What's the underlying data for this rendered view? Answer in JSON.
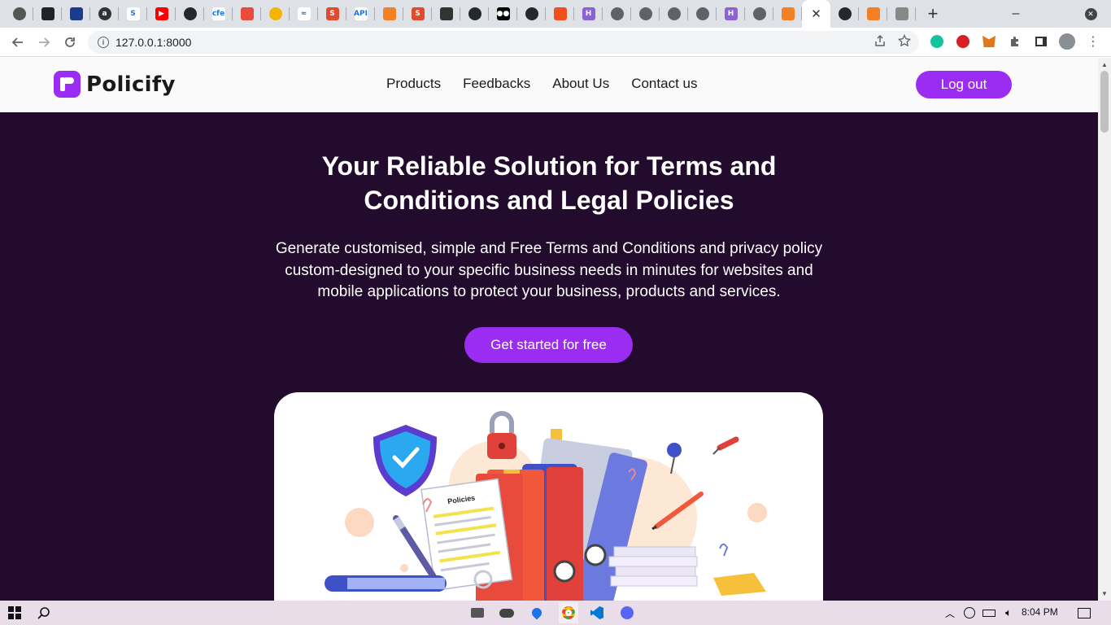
{
  "browser": {
    "tabs": [
      {
        "icon": "chrome-icon",
        "glyph": "",
        "color": "#555555"
      },
      {
        "icon": "react-icon",
        "glyph": "",
        "color": "#20232a"
      },
      {
        "icon": "flame-icon",
        "glyph": "",
        "color": "#1e3a8a"
      },
      {
        "icon": "a-circle-icon",
        "glyph": "a",
        "color": "#333333"
      },
      {
        "icon": "s-letter-icon",
        "glyph": "S",
        "color": "#ffffff"
      },
      {
        "icon": "youtube-icon",
        "glyph": "▶",
        "color": "#ff0000"
      },
      {
        "icon": "github-icon",
        "glyph": "",
        "color": "#24292e"
      },
      {
        "icon": "cfe-icon",
        "glyph": "cfe",
        "color": "#ffffff"
      },
      {
        "icon": "shield-red-icon",
        "glyph": "",
        "color": "#e74c3c"
      },
      {
        "icon": "colorful-circle-icon",
        "glyph": "",
        "color": "#f4b400"
      },
      {
        "icon": "tailwind-icon",
        "glyph": "≈",
        "color": "#ffffff"
      },
      {
        "icon": "s-red-icon",
        "glyph": "S",
        "color": "#e04a2f"
      },
      {
        "icon": "api-icon",
        "glyph": "API",
        "color": "#ffffff"
      },
      {
        "icon": "stackoverflow-icon",
        "glyph": "",
        "color": "#f48024"
      },
      {
        "icon": "s-red-icon",
        "glyph": "S",
        "color": "#e04a2f"
      },
      {
        "icon": "slash-box-icon",
        "glyph": "",
        "color": "#333333"
      },
      {
        "icon": "github-icon",
        "glyph": "",
        "color": "#24292e"
      },
      {
        "icon": "medium-icon",
        "glyph": "●●",
        "color": "#000000"
      },
      {
        "icon": "github-icon",
        "glyph": "",
        "color": "#24292e"
      },
      {
        "icon": "figma-icon",
        "glyph": "",
        "color": "#f24e1e"
      },
      {
        "icon": "h-purple-icon",
        "glyph": "H",
        "color": "#8a63d2"
      },
      {
        "icon": "globe-icon",
        "glyph": "",
        "color": "#5f6368"
      },
      {
        "icon": "globe-icon",
        "glyph": "",
        "color": "#5f6368"
      },
      {
        "icon": "globe-icon",
        "glyph": "",
        "color": "#5f6368"
      },
      {
        "icon": "globe-icon",
        "glyph": "",
        "color": "#5f6368"
      },
      {
        "icon": "h-purple-icon",
        "glyph": "H",
        "color": "#8a63d2"
      },
      {
        "icon": "globe-icon",
        "glyph": "",
        "color": "#5f6368"
      },
      {
        "icon": "stackoverflow-icon",
        "glyph": "",
        "color": "#f48024"
      }
    ],
    "active_tab_close": "✕",
    "after_tabs": [
      {
        "icon": "github-icon",
        "glyph": "",
        "color": "#24292e"
      },
      {
        "icon": "stackoverflow-icon",
        "glyph": "",
        "color": "#f48024"
      },
      {
        "icon": "video-camera-icon",
        "glyph": "",
        "color": "#888888"
      }
    ],
    "new_tab": "+",
    "minimize": "–",
    "close_window": "✕",
    "url": "127.0.0.1:8000"
  },
  "site": {
    "brand": "Policify",
    "nav": [
      "Products",
      "Feedbacks",
      "About Us",
      "Contact us"
    ],
    "logout": "Log out",
    "hero_title": "Your Reliable Solution for Terms and Conditions and Legal Policies",
    "hero_subtitle": "Generate customised, simple and Free Terms and Conditions and privacy policy custom-designed to your specific business needs in minutes for websites and mobile applications to protect your business, products and services.",
    "cta": "Get started for free",
    "illustration_doc_label": "Policies"
  },
  "taskbar": {
    "clock": "8:04 PM"
  },
  "colors": {
    "brand_purple": "#9b2cf2",
    "hero_bg": "#230b2e"
  }
}
